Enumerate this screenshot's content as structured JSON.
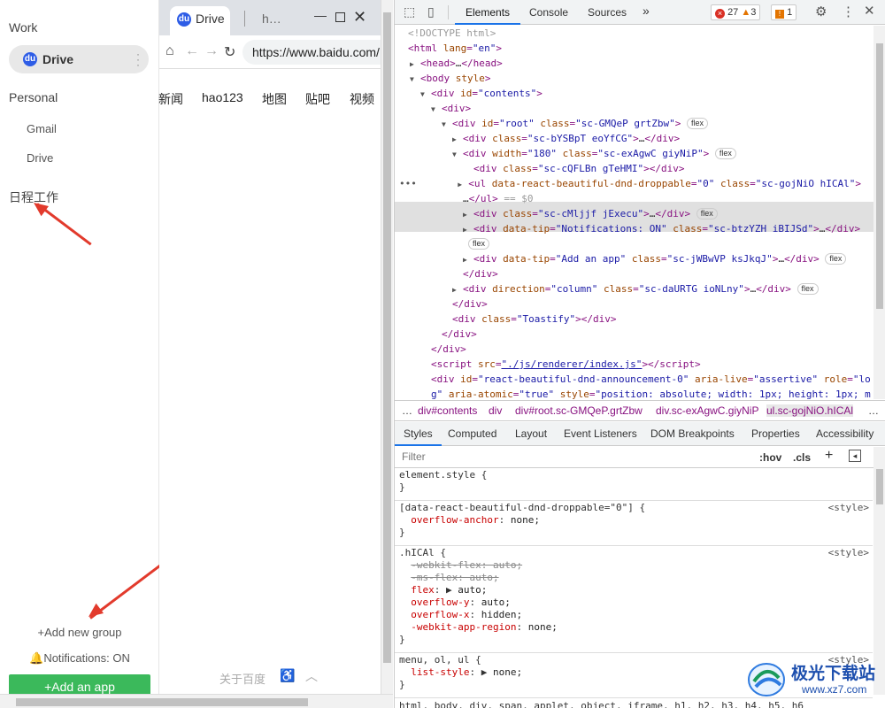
{
  "sidebar": {
    "work_label": "Work",
    "drive_label": "Drive",
    "personal_label": "Personal",
    "personal_items": [
      "Gmail",
      "Drive"
    ],
    "custom_group": "日程工作",
    "add_group": "Add new group",
    "notifications": "Notifications: ON",
    "add_app": "Add an app"
  },
  "browser": {
    "tab_active": "Drive",
    "tab_second": "h…",
    "url": "https://www.baidu.com/",
    "nav_links": [
      "新闻",
      "hao123",
      "地图",
      "贴吧",
      "视频"
    ],
    "footer": "关于百度"
  },
  "devtools": {
    "tabs": [
      "Elements",
      "Console",
      "Sources"
    ],
    "errors": "27",
    "warnings": "3",
    "issues": "1",
    "crumbs": [
      "div#contents",
      "div",
      "div#root.sc-GMQeP.grtZbw",
      "div.sc-exAgwC.giyNiP",
      "ul.sc-gojNiO.hICAl"
    ],
    "subtabs": [
      "Styles",
      "Computed",
      "Layout",
      "Event Listeners",
      "DOM Breakpoints",
      "Properties",
      "Accessibility"
    ],
    "filter_placeholder": "Filter",
    "hov": ":hov",
    "cls": ".cls",
    "bottom": "html, body, div, span, applet, object, iframe, h1, h2, h3, h4, h5, h6",
    "style_source": "<style>"
  },
  "watermark": {
    "cn": "极光下载站",
    "url": "www.xz7.com"
  },
  "colors": {
    "accent_green": "#3bb95b",
    "baidu_blue": "#2e5de6",
    "arrow_red": "#e23a2c",
    "devtools_blue": "#1a73e8"
  }
}
